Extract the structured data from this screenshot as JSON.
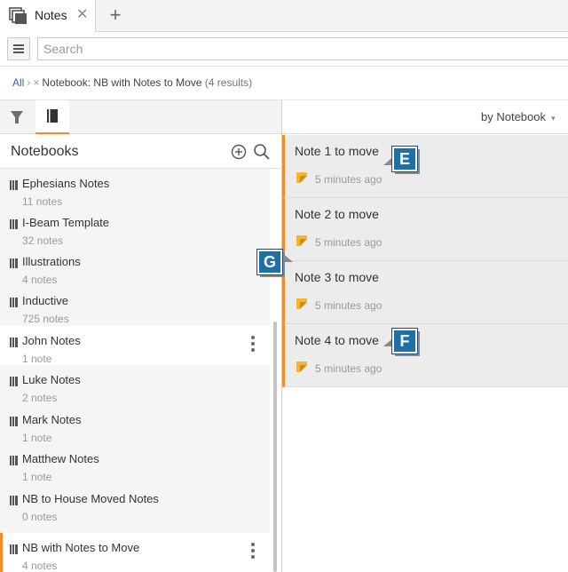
{
  "tab": {
    "label": "Notes",
    "close_glyph": "✕",
    "add_glyph": "+"
  },
  "search": {
    "placeholder": "Search",
    "value": ""
  },
  "breadcrumb": {
    "all_label": "All",
    "separator": "›",
    "remove_glyph": "×",
    "filter_label": "Notebook: NB with Notes to Move",
    "results": "(4 results)"
  },
  "toolbar": {
    "sort_label": "by Notebook",
    "sort_caret": "▾"
  },
  "notebooks_panel": {
    "title": "Notebooks",
    "items": [
      {
        "name": "Ephesians Notes",
        "count": "11 notes"
      },
      {
        "name": "I-Beam Template",
        "count": "32 notes"
      },
      {
        "name": "Illustrations",
        "count": "4 notes"
      },
      {
        "name": "Inductive",
        "count": "725 notes"
      },
      {
        "name": "John Notes",
        "count": "1 note"
      },
      {
        "name": "Luke Notes",
        "count": "2 notes"
      },
      {
        "name": "Mark Notes",
        "count": "1 note"
      },
      {
        "name": "Matthew Notes",
        "count": "1 note"
      },
      {
        "name": "NB to House Moved Notes",
        "count": "0 notes"
      },
      {
        "name": "NB with Notes to Move",
        "count": "4 notes"
      }
    ]
  },
  "notes_panel": {
    "notes": [
      {
        "title": "Note 1 to move",
        "time": "5 minutes ago"
      },
      {
        "title": "Note 2 to move",
        "time": "5 minutes ago"
      },
      {
        "title": "Note 3 to move",
        "time": "5 minutes ago"
      },
      {
        "title": "Note 4 to move",
        "time": "5 minutes ago"
      }
    ]
  },
  "callouts": {
    "e": "E",
    "f": "F",
    "g": "G"
  },
  "colors": {
    "accent": "#f08c2a",
    "callout": "#1f6fa8",
    "link": "#2b6aa8"
  }
}
